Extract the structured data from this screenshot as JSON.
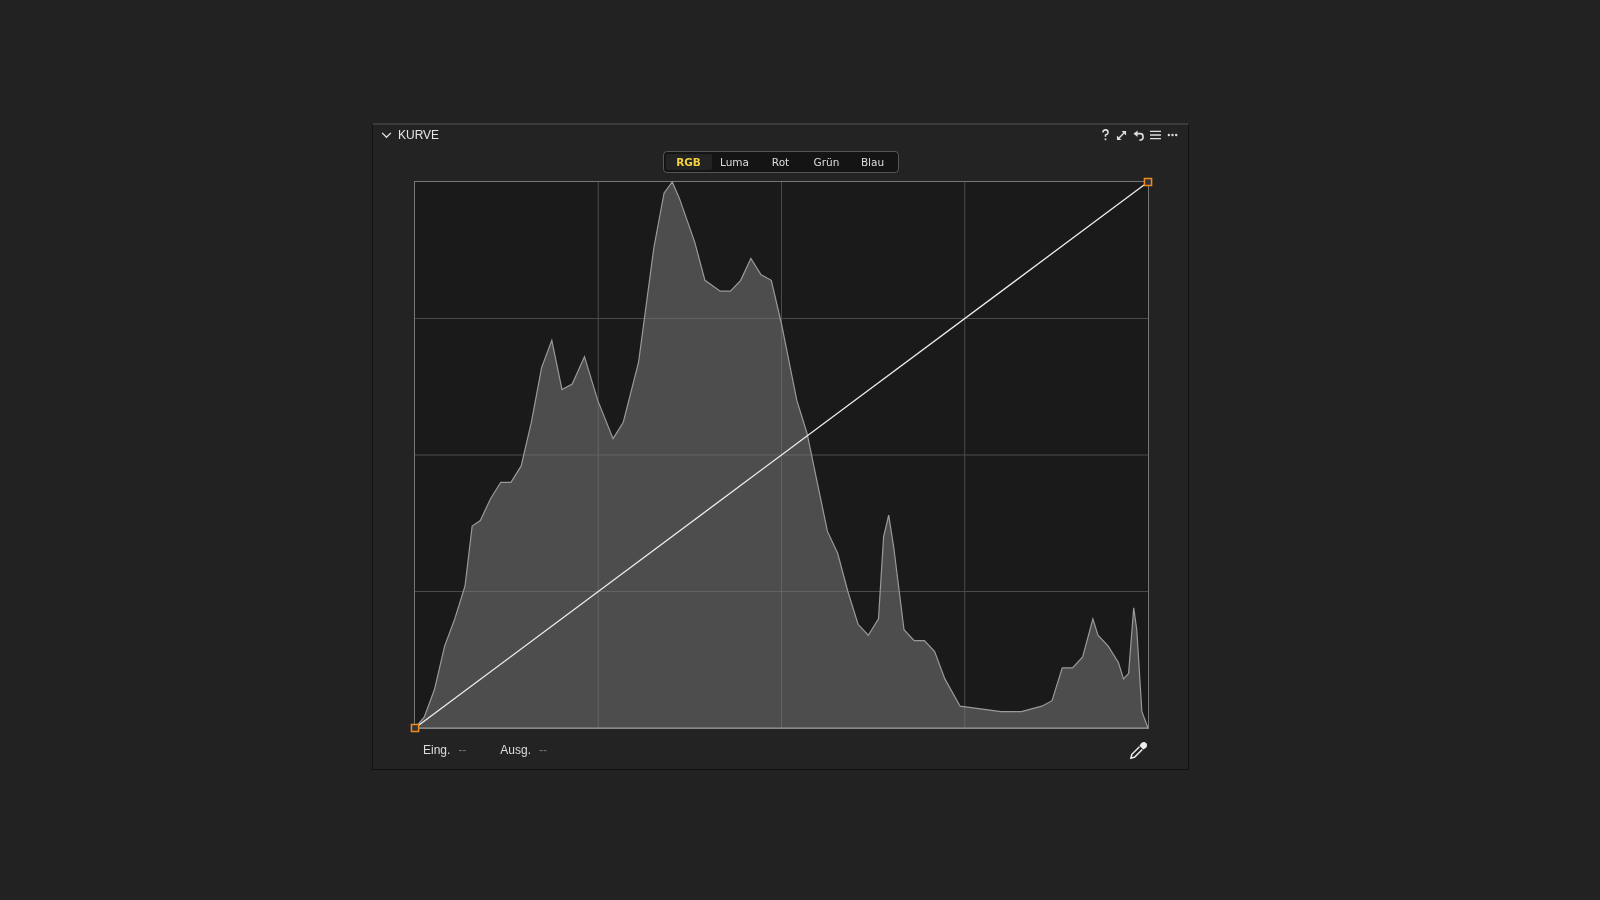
{
  "panel": {
    "title": "KURVE",
    "expanded": true
  },
  "tabs": [
    {
      "label": "RGB",
      "selected": true
    },
    {
      "label": "Luma",
      "selected": false
    },
    {
      "label": "Rot",
      "selected": false
    },
    {
      "label": "Grün",
      "selected": false
    },
    {
      "label": "Blau",
      "selected": false
    }
  ],
  "readouts": [
    {
      "label": "Eing.",
      "value": "--"
    },
    {
      "label": "Ausg.",
      "value": "--"
    }
  ]
}
